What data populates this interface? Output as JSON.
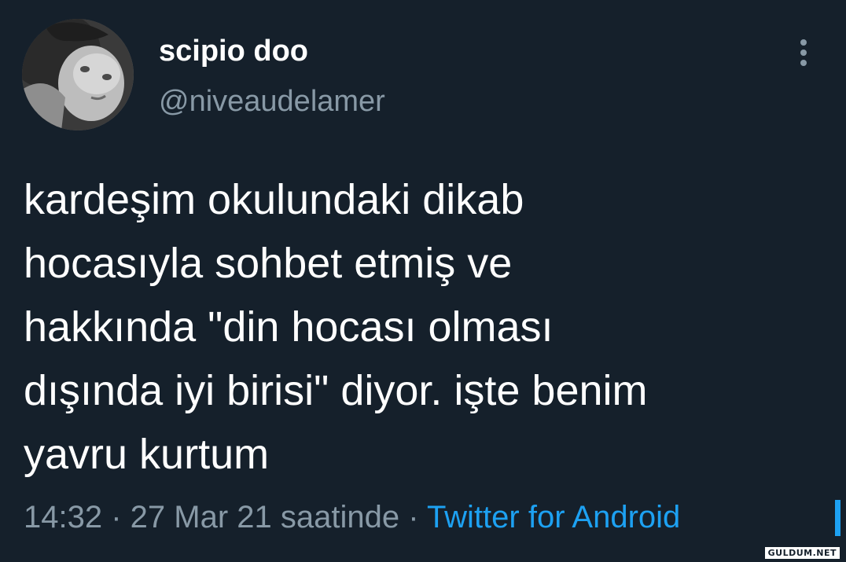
{
  "tweet": {
    "author": {
      "display_name": "scipio doo",
      "handle": "@niveaudelamer",
      "avatar_icon": "avatar-photo"
    },
    "more_icon": "more-vertical-icon",
    "text": "kardeşim okulundaki dikab\nhocasıyla sohbet etmiş ve\nhakkında \"din hocası olması\ndışında iyi birisi\" diyor. işte benim\nyavru kurtum",
    "time": "14:32",
    "separator": " · ",
    "date_text": "27 Mar 21 saatinde",
    "source": "Twitter for Android"
  },
  "colors": {
    "background": "#15202b",
    "primary_text": "#ffffff",
    "secondary_text": "#8899a6",
    "accent": "#1da1f2"
  },
  "watermark": "GULDUM.NET"
}
